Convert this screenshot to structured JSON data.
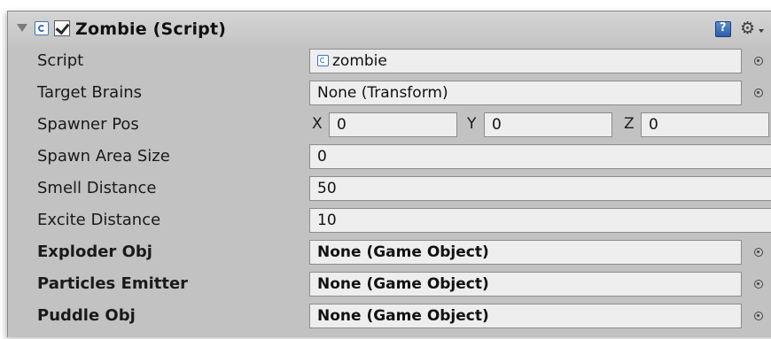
{
  "component": {
    "title": "Zombie (Script)",
    "enabled": true,
    "icons": {
      "foldout": "foldout-arrow-icon",
      "script": "script-icon",
      "help": "help-icon",
      "settings": "gear-icon"
    }
  },
  "fields": {
    "script": {
      "label": "Script",
      "value": "zombie"
    },
    "target_brains": {
      "label": "Target Brains",
      "value": "None (Transform)"
    },
    "spawner_pos": {
      "label": "Spawner Pos",
      "x_label": "X",
      "x_value": "0",
      "y_label": "Y",
      "y_value": "0",
      "z_label": "Z",
      "z_value": "0"
    },
    "spawn_area_size": {
      "label": "Spawn Area Size",
      "value": "0"
    },
    "smell_distance": {
      "label": "Smell Distance",
      "value": "50"
    },
    "excite_distance": {
      "label": "Excite Distance",
      "value": "10"
    },
    "exploder_obj": {
      "label": "Exploder Obj",
      "value": "None (Game Object)"
    },
    "particles_emitter": {
      "label": "Particles Emitter",
      "value": "None (Game Object)"
    },
    "puddle_obj": {
      "label": "Puddle Obj",
      "value": "None (Game Object)"
    }
  }
}
